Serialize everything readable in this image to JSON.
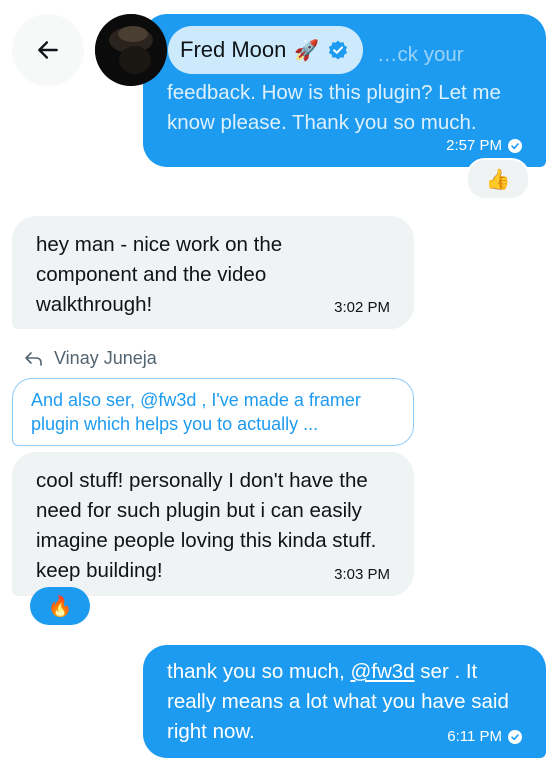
{
  "header": {
    "back_label": "Back",
    "contact_name": "Fred Moon",
    "name_emoji": "🚀"
  },
  "messages": [
    {
      "id": "m1",
      "direction": "outgoing",
      "text_visible": "feedback. How is this plugin? Let me know please. Thank you so much.",
      "text_hidden_prefix": "…ck your",
      "time": "2:57 PM",
      "reaction": "👍"
    },
    {
      "id": "m2",
      "direction": "incoming",
      "text": "hey man - nice work on the component and the video walkthrough!",
      "time": "3:02 PM"
    },
    {
      "id": "m3",
      "direction": "incoming",
      "reply_to": {
        "author": "Vinay Juneja",
        "preview": "And also ser, @fw3d , I've made a framer plugin which helps you to actually ..."
      },
      "text": "cool stuff! personally I don't have the need for such plugin but i can easily imagine people loving this kinda stuff. keep building!",
      "time": "3:03 PM",
      "reaction": "🔥"
    },
    {
      "id": "m4",
      "direction": "outgoing",
      "text_before_mention": "thank you so much, ",
      "mention": "@fw3d",
      "text_after_mention": " ser . It really means a lot what you have said right now.",
      "time": "6:11 PM"
    }
  ],
  "colors": {
    "outgoing_bubble": "#1d9bf0",
    "incoming_bubble": "#eff3f4",
    "verified_badge": "#1d9bf0",
    "quote_border": "#8ecdf8"
  },
  "icons": {
    "back": "arrow-left-icon",
    "verified": "verified-badge-icon",
    "read": "read-check-icon",
    "reply": "reply-arrow-icon"
  }
}
